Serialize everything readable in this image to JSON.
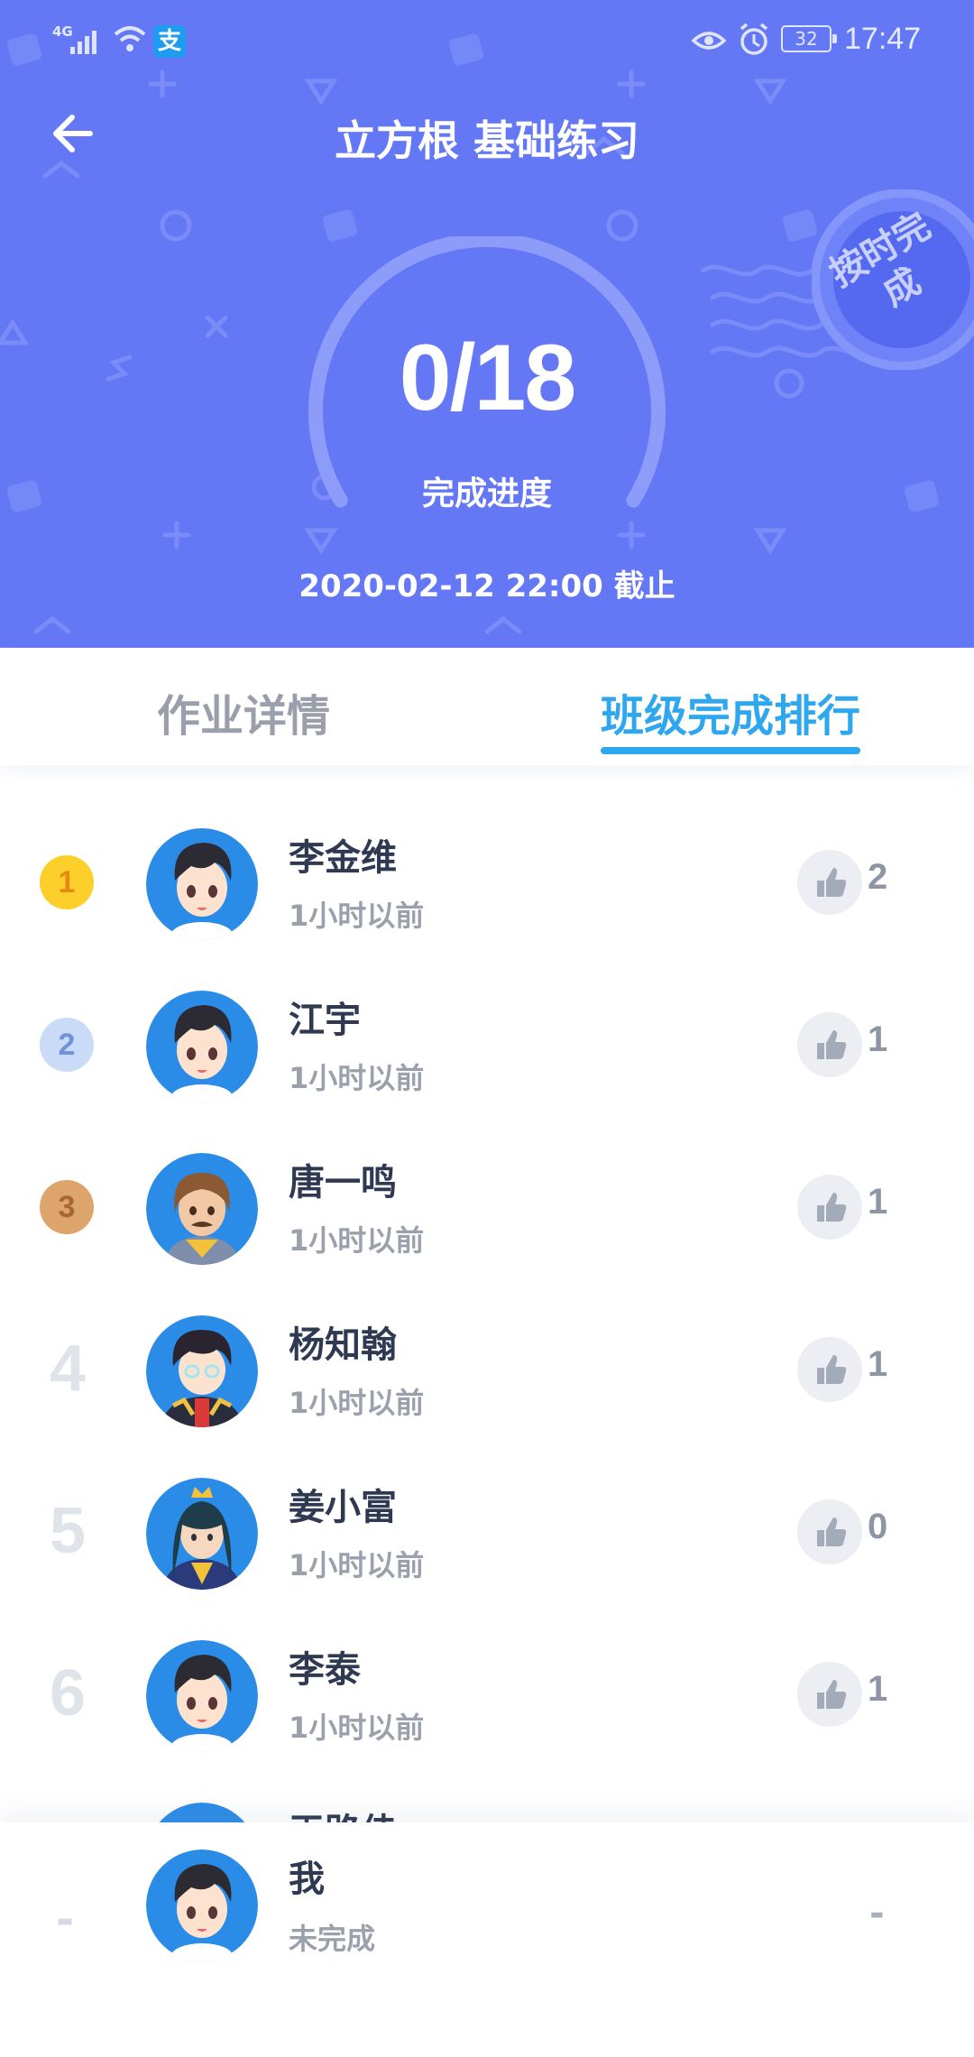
{
  "status_bar": {
    "network": "4G",
    "battery": "32",
    "time": "17:47",
    "pay_icon": "支"
  },
  "header": {
    "title": "立方根 基础练习",
    "progress_count": "0/18",
    "progress_label": "完成进度",
    "deadline": "2020-02-12 22:00 截止",
    "stamp_text": "按时完成"
  },
  "tabs": [
    {
      "label": "作业详情",
      "active": false
    },
    {
      "label": "班级完成排行",
      "active": true
    }
  ],
  "ranking": [
    {
      "rank": "1",
      "name": "李金维",
      "time": "1小时以前",
      "likes": "2"
    },
    {
      "rank": "2",
      "name": "江宇",
      "time": "1小时以前",
      "likes": "1"
    },
    {
      "rank": "3",
      "name": "唐一鸣",
      "time": "1小时以前",
      "likes": "1"
    },
    {
      "rank": "4",
      "name": "杨知翰",
      "time": "1小时以前",
      "likes": "1"
    },
    {
      "rank": "5",
      "name": "姜小富",
      "time": "1小时以前",
      "likes": "0"
    },
    {
      "rank": "6",
      "name": "李泰",
      "time": "1小时以前",
      "likes": "1"
    },
    {
      "rank": "",
      "name": "王路佳",
      "time": "",
      "likes": ""
    }
  ],
  "me": {
    "rank": "-",
    "name": "我",
    "status": "未完成",
    "score": "-"
  },
  "colors": {
    "header_bg": "#6478f6",
    "accent": "#2fa7ee",
    "gold": "#fccf2a",
    "silver": "#c9dbf7",
    "bronze": "#dda56c"
  }
}
